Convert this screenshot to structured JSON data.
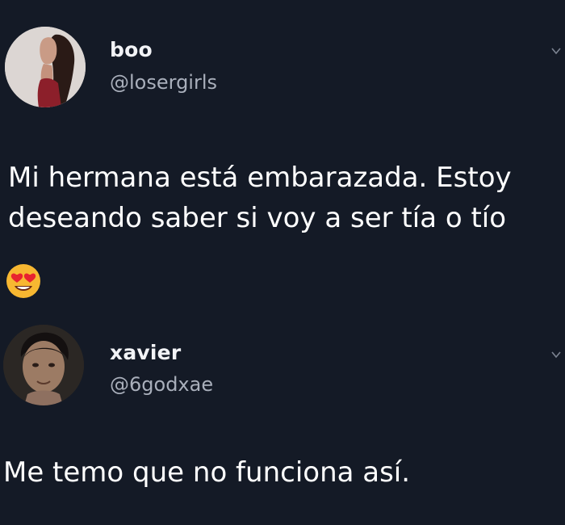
{
  "tweets": [
    {
      "name": "boo",
      "handle": "@losergirls",
      "text": "Mi hermana está embarazada. Estoy\ndeseando saber si voy a ser tía o tío",
      "emoji": "heart-eyes"
    },
    {
      "name": "xavier",
      "handle": "@6godxae",
      "text": "Me temo que no funciona así."
    }
  ],
  "colors": {
    "background": "#141a26",
    "name": "#f2f3f6",
    "handle": "#a9afbb",
    "text": "#ffffff"
  }
}
